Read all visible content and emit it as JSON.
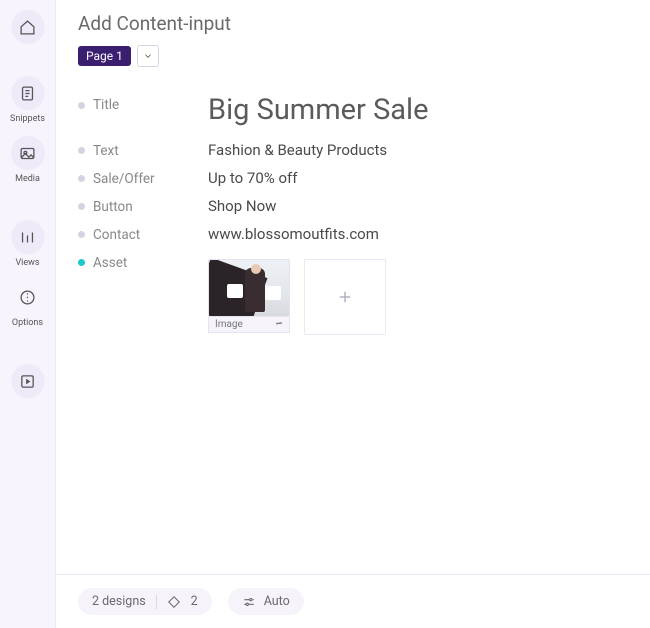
{
  "sidebar": {
    "items": [
      {
        "name": "home",
        "label": ""
      },
      {
        "name": "snippets",
        "label": "Snippets"
      },
      {
        "name": "media",
        "label": "Media"
      },
      {
        "name": "views",
        "label": "Views"
      },
      {
        "name": "options",
        "label": "Options"
      },
      {
        "name": "preview",
        "label": ""
      }
    ]
  },
  "header": {
    "title": "Add Content-input",
    "page_badge": "Page 1"
  },
  "fields": {
    "title": {
      "label": "Title",
      "value": "Big Summer Sale"
    },
    "text": {
      "label": "Text",
      "value": "Fashion & Beauty Products"
    },
    "offer": {
      "label": "Sale/Offer",
      "value": "Up to 70% off"
    },
    "button": {
      "label": "Button",
      "value": "Shop Now"
    },
    "contact": {
      "label": "Contact",
      "value": "www.blossomoutfits.com"
    },
    "asset": {
      "label": "Asset",
      "thumb_label": "Image"
    }
  },
  "footer": {
    "designs_text": "2 designs",
    "designs_count": "2",
    "auto_label": "Auto"
  }
}
